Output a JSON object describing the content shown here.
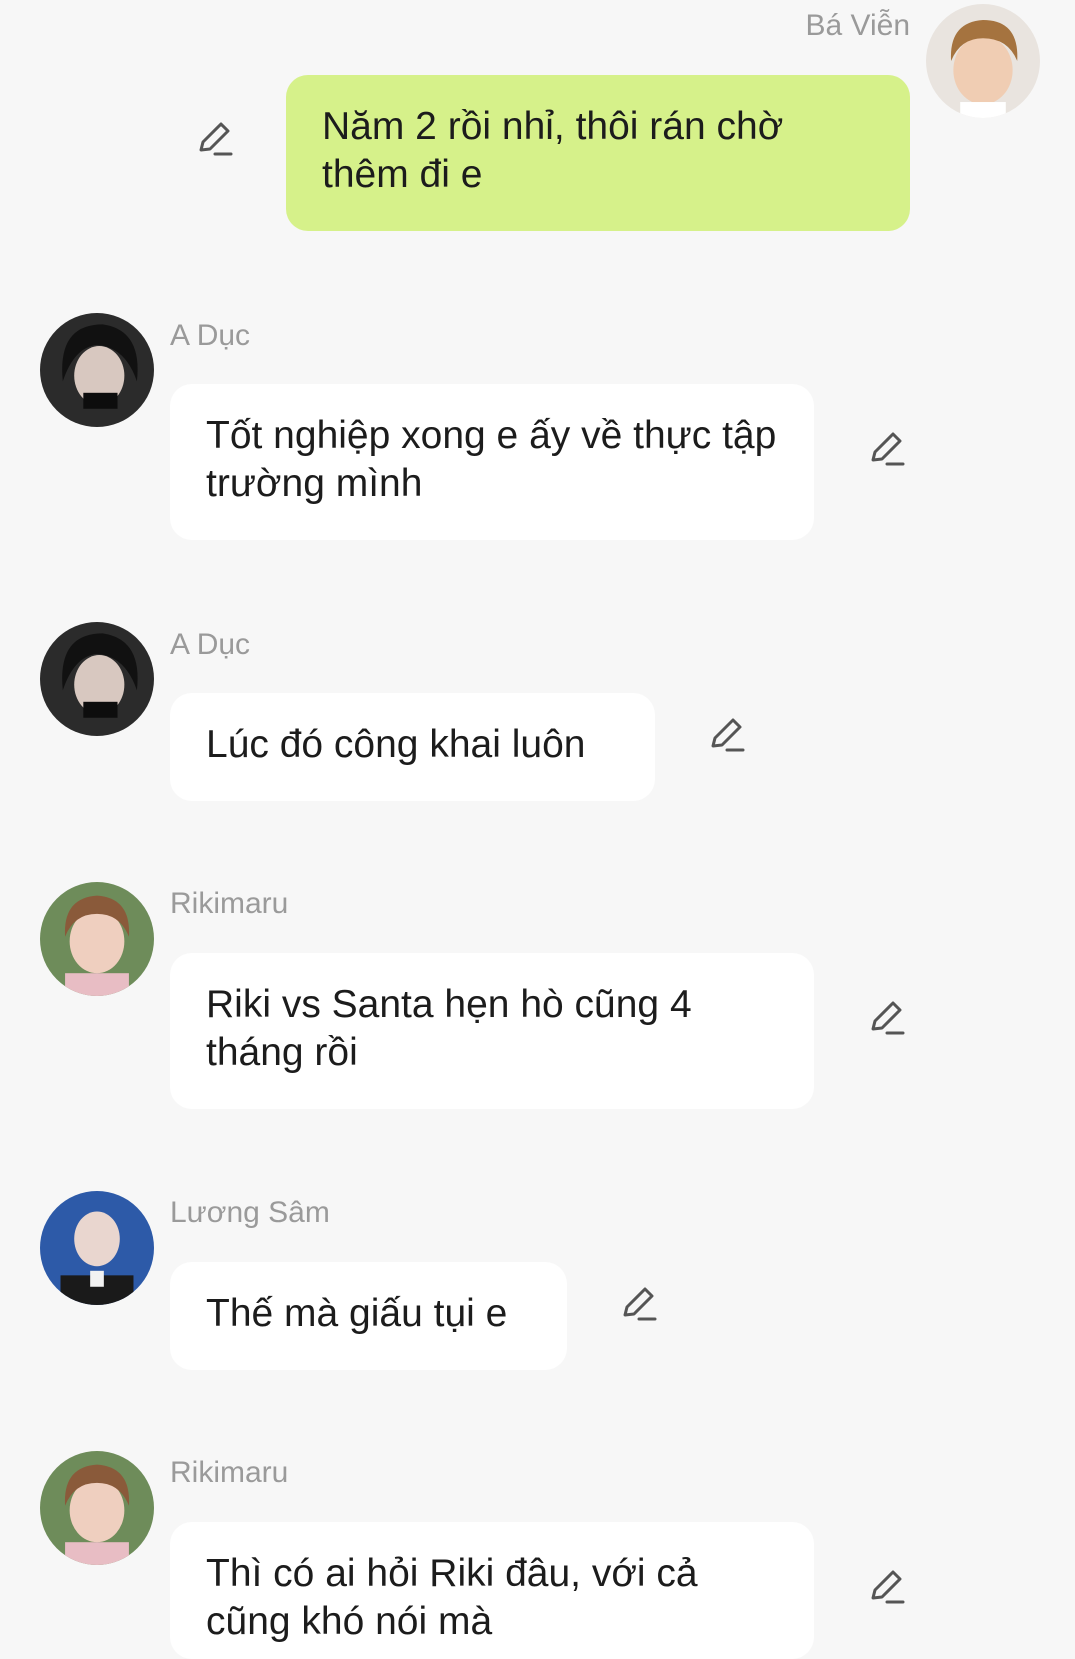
{
  "messages": [
    {
      "sender": "Bá Viễn",
      "text": "Năm 2 rồi nhỉ, thôi rán chờ thêm đi e",
      "outgoing": true,
      "avatar": "avatar-ba-vien"
    },
    {
      "sender": "A Dục",
      "text": "Tốt nghiệp xong e ấy về thực tập trường mình",
      "outgoing": false,
      "avatar": "avatar-a-duc"
    },
    {
      "sender": "A Dục",
      "text": "Lúc đó công khai luôn",
      "outgoing": false,
      "avatar": "avatar-a-duc"
    },
    {
      "sender": "Rikimaru",
      "text": "Riki vs Santa hẹn hò cũng 4 tháng rồi",
      "outgoing": false,
      "avatar": "avatar-rikimaru"
    },
    {
      "sender": "Lương Sâm",
      "text": "Thế mà giấu tụi e",
      "outgoing": false,
      "avatar": "avatar-luong-sam"
    },
    {
      "sender": "Rikimaru",
      "text": "Thì có ai hỏi Riki đâu, với cả cũng khó nói mà",
      "outgoing": false,
      "avatar": "avatar-rikimaru"
    }
  ],
  "icons": {
    "edit": "pencil-icon"
  },
  "colors": {
    "background": "#f7f7f7",
    "outgoing_bubble": "#d6f18a",
    "incoming_bubble": "#ffffff",
    "sender_name": "#9a9a9a"
  }
}
